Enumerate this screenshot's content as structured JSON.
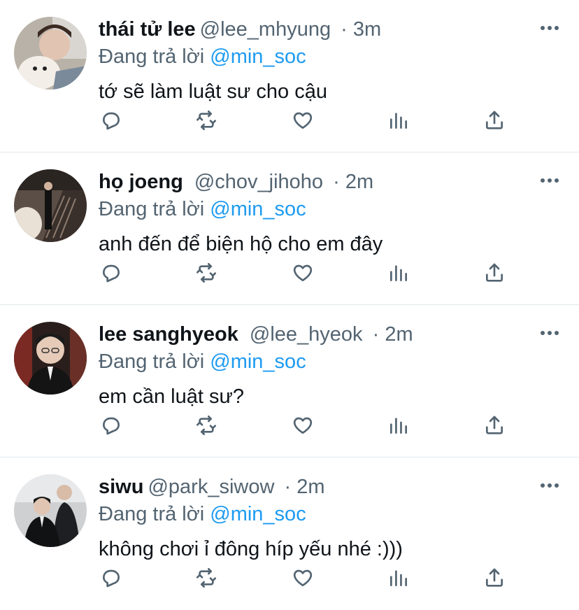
{
  "reply_prefix": "Đang trả lời",
  "tweets": [
    {
      "name": "thái tử lee",
      "handle": "@lee_mhyung",
      "time": "3m",
      "reply_to": "@min_soc",
      "text": "tớ sẽ làm luật sư cho cậu"
    },
    {
      "name": "họ joeng",
      "handle": "@chov_jihoho",
      "time": "2m",
      "reply_to": "@min_soc",
      "text": "anh đến để biện hộ cho em đây"
    },
    {
      "name": "lee sanghyeok",
      "handle": "@lee_hyeok",
      "time": "2m",
      "reply_to": "@min_soc",
      "text": "em cần luật sư?"
    },
    {
      "name": "siwu",
      "handle": "@park_siwow",
      "time": "2m",
      "reply_to": "@min_soc",
      "text": "không chơi ỉ đông híp yếu nhé :)))"
    }
  ],
  "icons": {
    "reply": "reply-icon",
    "retweet": "retweet-icon",
    "like": "heart-icon",
    "stats": "analytics-icon",
    "share": "share-icon",
    "more": "more-icon"
  },
  "colors": {
    "accent": "#1d9bf0",
    "secondary_text": "#536471",
    "divider": "#e1e8ed"
  }
}
